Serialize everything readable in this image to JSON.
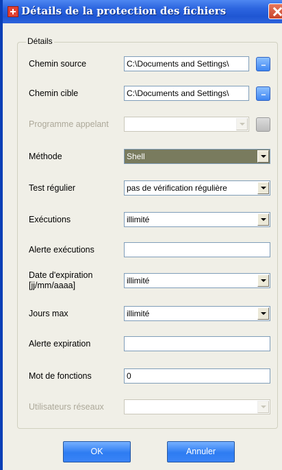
{
  "window": {
    "title": "Détails de la protection des fichiers"
  },
  "group": {
    "legend": "Détails"
  },
  "fields": {
    "source": {
      "label": "Chemin source",
      "value": "C:\\Documents and Settings\\"
    },
    "target": {
      "label": "Chemin cible",
      "value": "C:\\Documents and Settings\\"
    },
    "caller": {
      "label": "Programme appelant",
      "value": ""
    },
    "method": {
      "label": "Méthode",
      "value": "Shell"
    },
    "regular_test": {
      "label": "Test régulier",
      "value": "pas de vérification régulière"
    },
    "executions": {
      "label": "Exécutions",
      "value": "illimité"
    },
    "exec_alert": {
      "label": "Alerte exécutions",
      "value": ""
    },
    "expiry_date": {
      "label": "Date d'expiration [jj/mm/aaaa]",
      "value": "illimité"
    },
    "max_days": {
      "label": "Jours max",
      "value": "illimité"
    },
    "expiry_alert": {
      "label": "Alerte expiration",
      "value": ""
    },
    "password": {
      "label": "Mot de fonctions",
      "value": "0"
    },
    "network_users": {
      "label": "Utilisateurs réseaux",
      "value": ""
    }
  },
  "browse_label": "...",
  "buttons": {
    "ok": "OK",
    "cancel": "Annuler"
  }
}
